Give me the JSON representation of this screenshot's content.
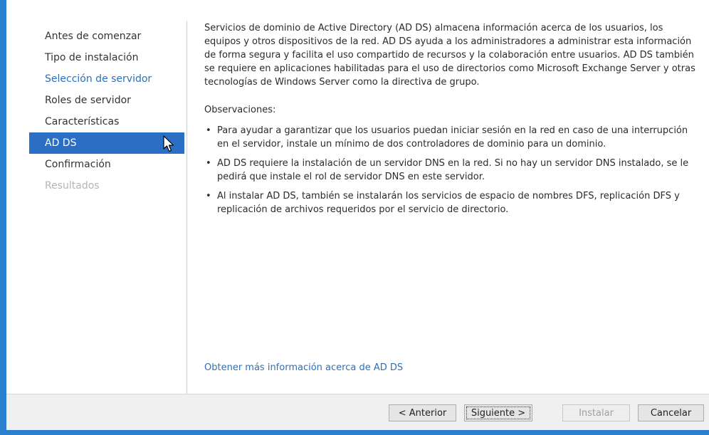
{
  "nav": {
    "items": [
      {
        "label": "Antes de comenzar",
        "state": "normal"
      },
      {
        "label": "Tipo de instalación",
        "state": "normal"
      },
      {
        "label": "Selección de servidor",
        "state": "link"
      },
      {
        "label": "Roles de servidor",
        "state": "normal"
      },
      {
        "label": "Características",
        "state": "normal"
      },
      {
        "label": "AD DS",
        "state": "active"
      },
      {
        "label": "Confirmación",
        "state": "normal"
      },
      {
        "label": "Resultados",
        "state": "disabled"
      }
    ]
  },
  "content": {
    "intro": "Servicios de dominio de Active Directory (AD DS) almacena información acerca de los usuarios, los equipos y otros dispositivos de la red. AD DS ayuda a los administradores a administrar esta información de forma segura y facilita el uso compartido de recursos y la colaboración entre usuarios. AD DS también se requiere en aplicaciones habilitadas para el uso de directorios como Microsoft Exchange Server y otras tecnologías de Windows Server como la directiva de grupo.",
    "observations_heading": "Observaciones:",
    "bullets": [
      "Para ayudar a garantizar que los usuarios puedan iniciar sesión en la red en caso de una interrupción en el servidor, instale un mínimo de dos controladores de dominio para un dominio.",
      "AD DS requiere la instalación de un servidor DNS en la red. Si no hay un servidor DNS instalado, se le pedirá que instale el rol de servidor DNS en este servidor.",
      "Al instalar AD DS, también se instalarán los servicios de espacio de nombres DFS, replicación DFS y replicación de archivos requeridos por el servicio de directorio."
    ],
    "bullet_glyph": "•",
    "more_info_link": "Obtener más información acerca de AD DS"
  },
  "footer": {
    "previous_label": "< Anterior",
    "next_label": "Siguiente >",
    "install_label": "Instalar",
    "cancel_label": "Cancelar"
  },
  "colors": {
    "accent": "#2b6fc4",
    "link": "#2e6fb8",
    "window_border": "#2b7fcf",
    "disabled_text": "#b5b5b5"
  }
}
